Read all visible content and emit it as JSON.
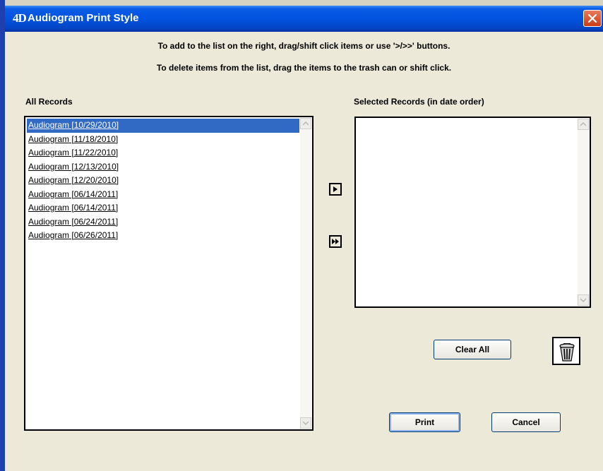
{
  "window": {
    "title": "Audiogram Print Style",
    "logo": "4D"
  },
  "instructions": {
    "line1": "To add to the list on the right, drag/shift click items or use '>/>>' buttons.",
    "line2": "To delete items from the list, drag the items to the trash can or shift click."
  },
  "all_records": {
    "label": "All Records",
    "items": [
      "Audiogram  [10/29/2010]",
      "Audiogram  [11/18/2010]",
      "Audiogram  [11/22/2010]",
      "Audiogram  [12/13/2010]",
      "Audiogram  [12/20/2010]",
      "Audiogram  [06/14/2011]",
      "Audiogram  [06/14/2011]",
      "Audiogram  [06/24/2011]",
      "Audiogram  [06/26/2011]"
    ],
    "selected_index": 0
  },
  "selected_records": {
    "label": "Selected Records (in date order)",
    "items": []
  },
  "buttons": {
    "clear_all": "Clear All",
    "print": "Print",
    "cancel": "Cancel"
  },
  "icons": {
    "add_one": "play-icon",
    "add_all": "fast-forward-icon",
    "trash": "trash-can-icon",
    "close": "close-icon"
  },
  "colors": {
    "titlebar": "#0153e0",
    "selection": "#316ac5",
    "dialog_bg": "#ece9d8"
  }
}
